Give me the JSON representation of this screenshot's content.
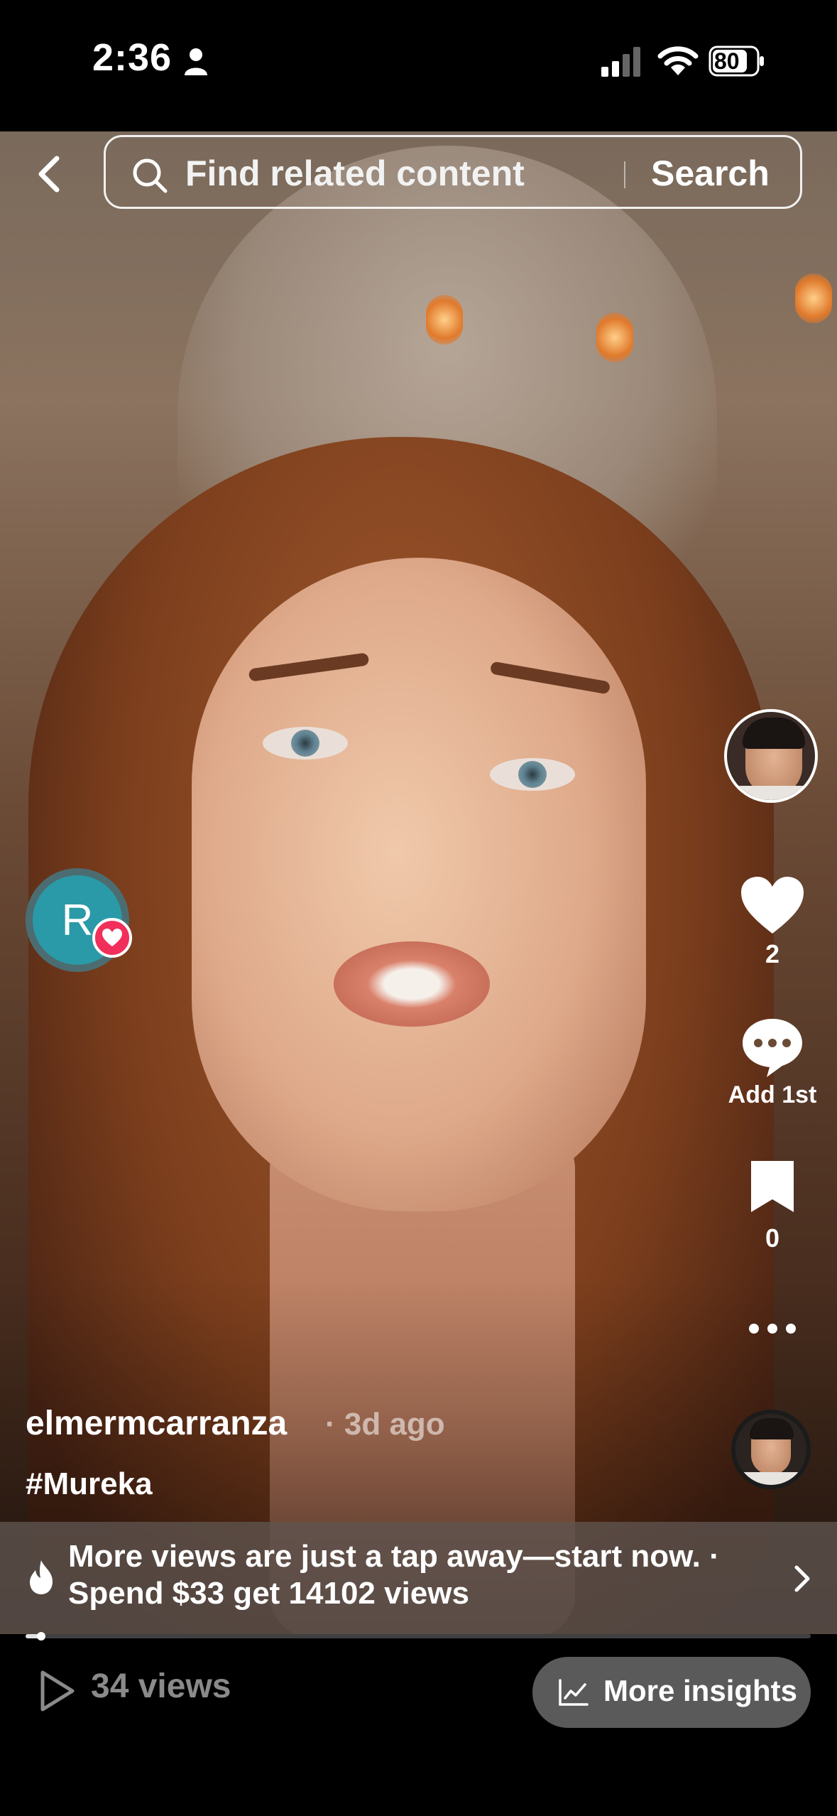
{
  "status_bar": {
    "time": "2:36",
    "battery": "80"
  },
  "search": {
    "placeholder": "Find related content",
    "button": "Search"
  },
  "actions": {
    "likes": "2",
    "comments": "Add 1st",
    "saves": "0"
  },
  "floating_avatar": {
    "initial": "R"
  },
  "caption": {
    "username": "elmermcarranza",
    "age": "· 3d ago",
    "hashtag": "#Mureka"
  },
  "promo": {
    "line1": "More views are just a tap away—start now. ·",
    "line2": "Spend $33 get 14102 views"
  },
  "playback": {
    "progress_fraction": 0.02
  },
  "bottom": {
    "views": "34 views",
    "insights_label": "More insights"
  },
  "colors": {
    "accent_heart": "#f0305a",
    "avatar_teal": "#2a9aa8",
    "insights_bg": "#5a5a5a"
  },
  "icons": [
    "person-icon",
    "cellular-signal-icon",
    "wifi-icon",
    "battery-icon",
    "back-chevron-icon",
    "search-icon",
    "heart-icon",
    "comment-bubble-icon",
    "bookmark-icon",
    "more-dots-icon",
    "fire-icon",
    "chevron-right-icon",
    "play-icon",
    "chart-icon"
  ]
}
